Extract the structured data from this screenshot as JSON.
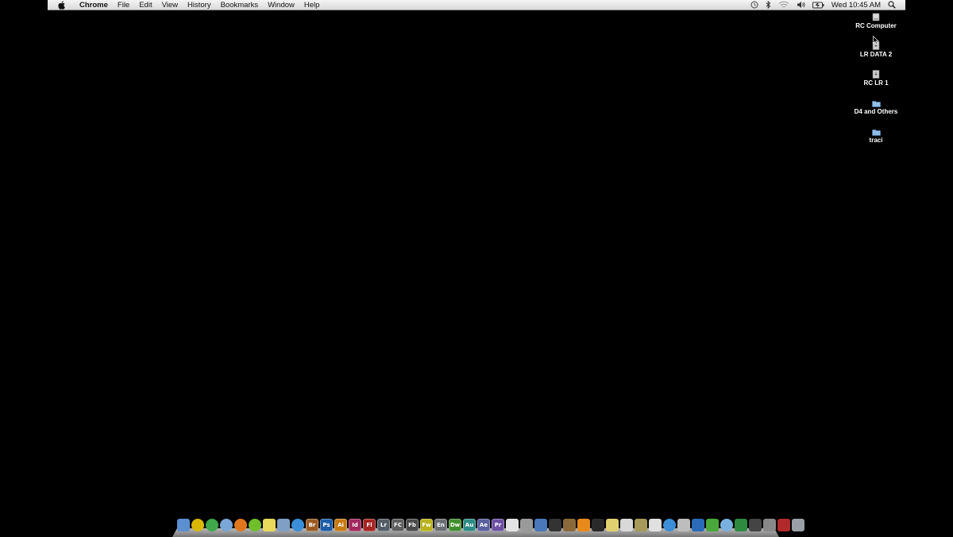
{
  "menubar": {
    "app_name": "Chrome",
    "menus": [
      "File",
      "Edit",
      "View",
      "History",
      "Bookmarks",
      "Window",
      "Help"
    ],
    "clock": "Wed 10:45 AM",
    "status_icons": [
      "time-machine-icon",
      "bluetooth-icon",
      "wifi-icon",
      "volume-icon",
      "battery-icon",
      "spotlight-icon"
    ]
  },
  "desktop_icons": [
    {
      "label": "RC Computer",
      "icon": "hard-drive-icon"
    },
    {
      "label": "LR DATA 2",
      "icon": "external-drive-icon"
    },
    {
      "label": "RC LR 1",
      "icon": "external-drive-icon"
    },
    {
      "label": "D4 and Others",
      "icon": "folder-icon"
    },
    {
      "label": "traci",
      "icon": "folder-icon"
    }
  ],
  "dock": {
    "items": [
      {
        "label": "",
        "name": "finder",
        "color": "#5b8fd0"
      },
      {
        "label": "",
        "name": "quicksilver",
        "color": "#d9b800"
      },
      {
        "label": "",
        "name": "chrome",
        "color": "#3ea84a"
      },
      {
        "label": "",
        "name": "safari",
        "color": "#7aa6d8"
      },
      {
        "label": "",
        "name": "firefox",
        "color": "#e0771e"
      },
      {
        "label": "",
        "name": "spotify",
        "color": "#6fbf2a"
      },
      {
        "label": "",
        "name": "notes",
        "color": "#e8d95a"
      },
      {
        "label": "",
        "name": "preview",
        "color": "#7f9fc4"
      },
      {
        "label": "",
        "name": "quicktime",
        "color": "#3a8fd8"
      },
      {
        "label": "Br",
        "name": "bridge",
        "color": "#9a5b23"
      },
      {
        "label": "Ps",
        "name": "photoshop",
        "color": "#1e5ea8"
      },
      {
        "label": "Ai",
        "name": "illustrator",
        "color": "#c87a12"
      },
      {
        "label": "Id",
        "name": "indesign",
        "color": "#a3285f"
      },
      {
        "label": "Fl",
        "name": "flash",
        "color": "#a82424"
      },
      {
        "label": "Lr",
        "name": "lightroom",
        "color": "#555d66"
      },
      {
        "label": "FC",
        "name": "flash-catalyst",
        "color": "#5e5e5e"
      },
      {
        "label": "Fb",
        "name": "flash-builder",
        "color": "#4a4a4a"
      },
      {
        "label": "Fw",
        "name": "fireworks",
        "color": "#b8b21b"
      },
      {
        "label": "En",
        "name": "encore",
        "color": "#6a6e74"
      },
      {
        "label": "Dw",
        "name": "dreamweaver",
        "color": "#3f8f2e"
      },
      {
        "label": "Au",
        "name": "audition",
        "color": "#2d8c86"
      },
      {
        "label": "Ae",
        "name": "after-effects",
        "color": "#5a5fa0"
      },
      {
        "label": "Pr",
        "name": "premiere",
        "color": "#6c4fa3"
      },
      {
        "label": "",
        "name": "acrobat",
        "color": "#e3e3e3"
      },
      {
        "label": "",
        "name": "address-book",
        "color": "#9a9a9a"
      },
      {
        "label": "",
        "name": "image-capture",
        "color": "#4a78b8"
      },
      {
        "label": "",
        "name": "iphone-config",
        "color": "#333333"
      },
      {
        "label": "",
        "name": "automator",
        "color": "#8a6a3a"
      },
      {
        "label": "",
        "name": "vlc",
        "color": "#e88a1a"
      },
      {
        "label": "",
        "name": "terminal",
        "color": "#2a2a2a"
      },
      {
        "label": "",
        "name": "stickies",
        "color": "#e0d070"
      },
      {
        "label": "",
        "name": "calendar",
        "color": "#d8d8d8"
      },
      {
        "label": "",
        "name": "script-editor",
        "color": "#a89a5a"
      },
      {
        "label": "",
        "name": "textedit",
        "color": "#e0e0e0"
      },
      {
        "label": "",
        "name": "app-store",
        "color": "#3c8ed8"
      },
      {
        "label": "",
        "name": "utility",
        "color": "#bdbdbd"
      },
      {
        "label": "",
        "name": "wacom",
        "color": "#2a6ab8"
      },
      {
        "label": "",
        "name": "crossover",
        "color": "#4aa83a"
      },
      {
        "label": "",
        "name": "network",
        "color": "#7ab0e0"
      },
      {
        "label": "",
        "name": "brush",
        "color": "#2e8a3e"
      },
      {
        "label": "",
        "name": "display",
        "color": "#444444"
      },
      {
        "label": "",
        "name": "window-app",
        "color": "#888888"
      },
      {
        "label": "",
        "name": "photo-booth",
        "color": "#b02a2a"
      },
      {
        "label": "",
        "name": "trash",
        "color": "#9aa0a6"
      }
    ]
  },
  "colors": {
    "desktop": "#000000",
    "menubar": "#e6e6e6",
    "folder": "#8fbde8"
  }
}
